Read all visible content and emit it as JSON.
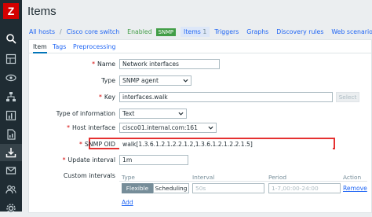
{
  "app": {
    "logo_text": "Z",
    "brand_color": "#d40000",
    "sidebar_icons": [
      "search-icon",
      "dashboard-icon",
      "eye-icon",
      "network-icon",
      "chart-icon",
      "report-icon",
      "data-collection-icon",
      "mail-icon",
      "users-icon",
      "settings-icon"
    ]
  },
  "page": {
    "title": "Items"
  },
  "breadcrumb": {
    "all_hosts": "All hosts",
    "sep": "/",
    "host": "Cisco core switch",
    "status": "Enabled",
    "snmp_badge": "SNMP",
    "items_tab": "Items",
    "items_count": "1",
    "triggers": "Triggers",
    "graphs": "Graphs",
    "discovery": "Discovery rules",
    "web": "Web scenarios"
  },
  "tabs": {
    "item": "Item",
    "tags": "Tags",
    "preprocessing": "Preprocessing"
  },
  "form": {
    "required_mark": "*",
    "name_label": "Name",
    "name_value": "Network interfaces",
    "type_label": "Type",
    "type_value": "SNMP agent",
    "key_label": "Key",
    "key_value": "interfaces.walk",
    "key_select_button": "Select",
    "info_type_label": "Type of information",
    "info_type_value": "Text",
    "host_interface_label": "Host interface",
    "host_interface_value": "cisco01.internal.com:161",
    "snmp_oid_label": "SNMP OID",
    "snmp_oid_value": "walk[1.3.6.1.2.1.2.2.1.2,1.3.6.1.2.1.2.2.1.5]",
    "update_interval_label": "Update interval",
    "update_interval_value": "1m",
    "custom_intervals_label": "Custom intervals",
    "ci_type_header": "Type",
    "ci_interval_header": "Interval",
    "ci_period_header": "Period",
    "ci_action_header": "Action",
    "ci_flexible": "Flexible",
    "ci_scheduling": "Scheduling",
    "ci_interval_placeholder": "50s",
    "ci_period_placeholder": "1-7,00:00-24:00",
    "ci_remove": "Remove",
    "ci_add": "Add"
  },
  "colors": {
    "highlight": "#e53131",
    "link": "#1f65f4",
    "enabled": "#429e47"
  }
}
